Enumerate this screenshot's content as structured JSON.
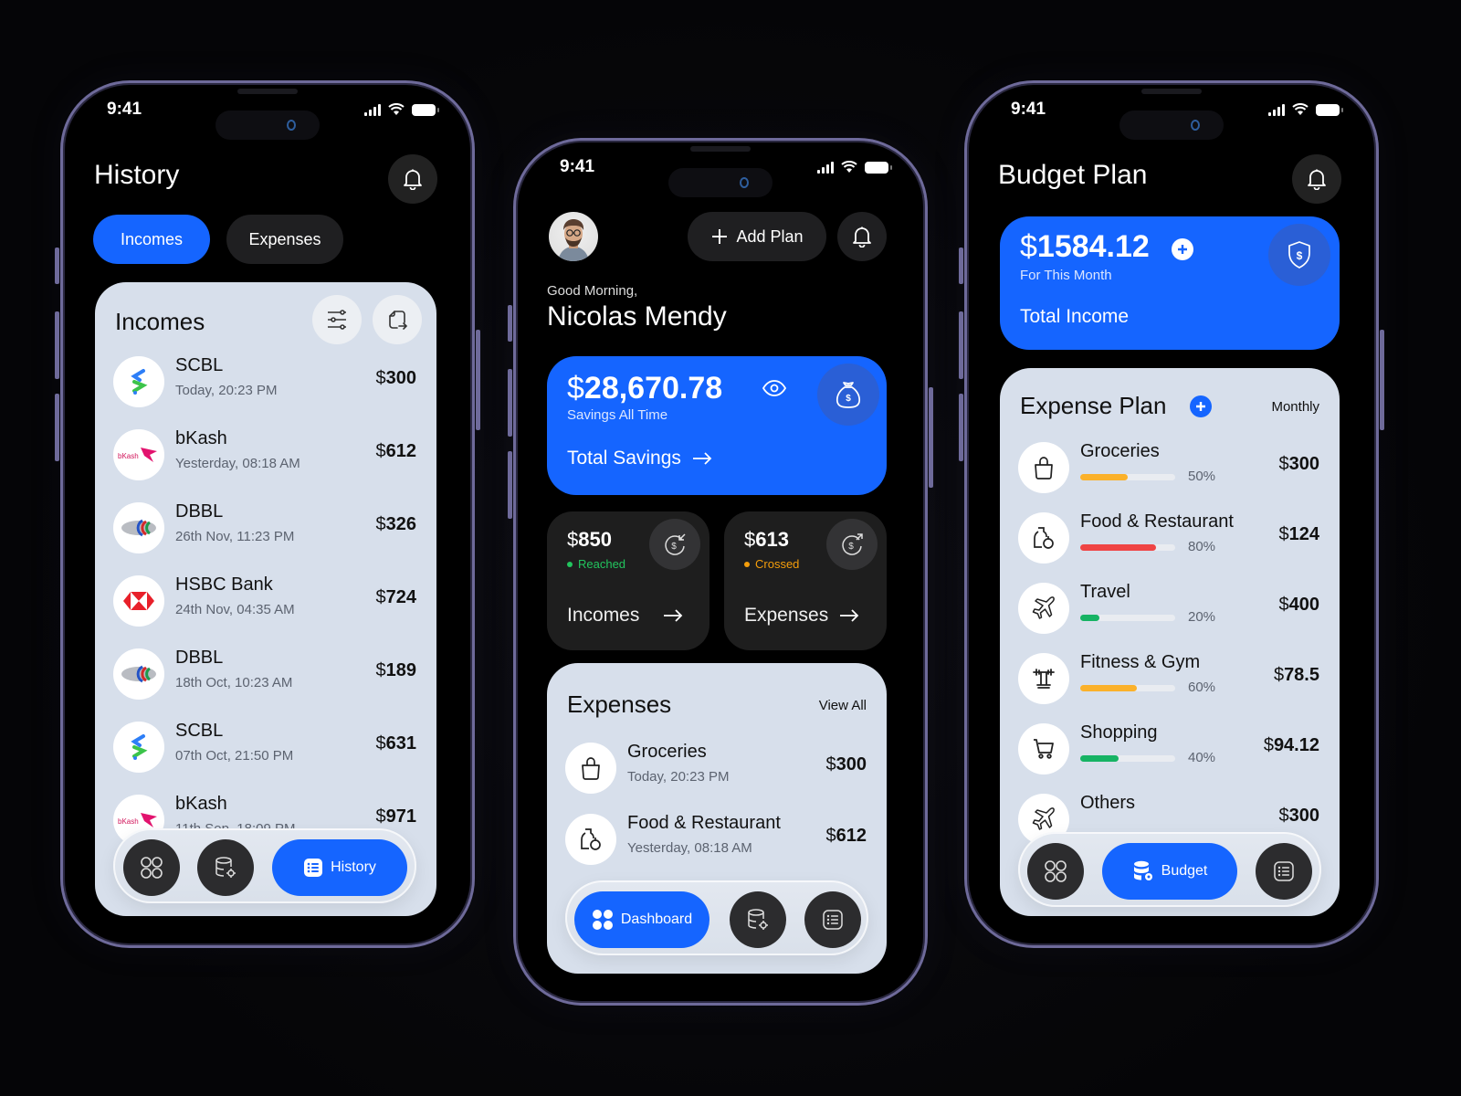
{
  "status_bar": {
    "time": "9:41"
  },
  "colors": {
    "accent": "#1565ff",
    "reached": "#22c55e",
    "crossed": "#f59e0b",
    "bar_yellow": "#fbb12a",
    "bar_red": "#ef4444",
    "bar_green": "#16b364"
  },
  "history_screen": {
    "title": "History",
    "tabs": [
      {
        "label": "Incomes",
        "active": true
      },
      {
        "label": "Expenses",
        "active": false
      }
    ],
    "panel_title": "Incomes",
    "panel_icons": [
      "filter-sliders-icon",
      "export-icon"
    ],
    "transactions": [
      {
        "name": "SCBL",
        "time": "Today, 20:23 PM",
        "currency": "$",
        "amount": "300",
        "logo": "scbl-logo"
      },
      {
        "name": "bKash",
        "time": "Yesterday, 08:18 AM",
        "currency": "$",
        "amount": "612",
        "logo": "bkash-logo"
      },
      {
        "name": "DBBL",
        "time": "26th Nov, 11:23 PM",
        "currency": "$",
        "amount": "326",
        "logo": "dbbl-logo"
      },
      {
        "name": "HSBC Bank",
        "time": "24th Nov, 04:35 AM",
        "currency": "$",
        "amount": "724",
        "logo": "hsbc-logo"
      },
      {
        "name": "DBBL",
        "time": "18th Oct, 10:23 AM",
        "currency": "$",
        "amount": "189",
        "logo": "dbbl-logo"
      },
      {
        "name": "SCBL",
        "time": "07th Oct, 21:50 PM",
        "currency": "$",
        "amount": "631",
        "logo": "scbl-logo"
      },
      {
        "name": "bKash",
        "time": "11th Sep, 18:09 PM",
        "currency": "$",
        "amount": "971",
        "logo": "bkash-logo"
      }
    ],
    "nav": {
      "active_label": "History"
    }
  },
  "dashboard_screen": {
    "add_plan_label": "Add Plan",
    "greeting": "Good Morning,",
    "user_name": "Nicolas Mendy",
    "savings": {
      "currency": "$",
      "amount": "28,670.78",
      "caption": "Savings All Time",
      "link": "Total Savings"
    },
    "incomes_card": {
      "currency": "$",
      "amount": "850",
      "status": "Reached",
      "label": "Incomes"
    },
    "expenses_card": {
      "currency": "$",
      "amount": "613",
      "status": "Crossed",
      "label": "Expenses"
    },
    "expenses_panel": {
      "title": "Expenses",
      "view_all": "View All",
      "items": [
        {
          "name": "Groceries",
          "time": "Today, 20:23 PM",
          "currency": "$",
          "amount": "300",
          "icon": "shopping-bag-icon"
        },
        {
          "name": "Food & Restaurant",
          "time": "Yesterday, 08:18 AM",
          "currency": "$",
          "amount": "612",
          "icon": "food-bottle-apple-icon"
        }
      ]
    },
    "nav": {
      "active_label": "Dashboard"
    }
  },
  "budget_screen": {
    "title": "Budget Plan",
    "income": {
      "currency": "$",
      "amount": "1584.12",
      "caption": "For This Month",
      "label": "Total Income"
    },
    "plan_title": "Expense Plan",
    "period": "Monthly",
    "plans": [
      {
        "name": "Groceries",
        "percent": 50,
        "percent_label": "50%",
        "currency": "$",
        "amount": "300",
        "color": "#fbb12a",
        "icon": "shopping-bag-icon"
      },
      {
        "name": "Food & Restaurant",
        "percent": 80,
        "percent_label": "80%",
        "currency": "$",
        "amount": "124",
        "color": "#ef4444",
        "icon": "food-bottle-apple-icon"
      },
      {
        "name": "Travel",
        "percent": 20,
        "percent_label": "20%",
        "currency": "$",
        "amount": "400",
        "color": "#16b364",
        "icon": "airplane-icon"
      },
      {
        "name": "Fitness & Gym",
        "percent": 60,
        "percent_label": "60%",
        "currency": "$",
        "amount": "78.5",
        "color": "#fbb12a",
        "icon": "dumbbell-icon"
      },
      {
        "name": "Shopping",
        "percent": 40,
        "percent_label": "40%",
        "currency": "$",
        "amount": "94.12",
        "color": "#16b364",
        "icon": "shopping-cart-icon"
      },
      {
        "name": "Others",
        "percent": null,
        "percent_label": "",
        "currency": "$",
        "amount": "300",
        "color": "#16b364",
        "icon": "airplane-icon"
      }
    ],
    "nav": {
      "active_label": "Budget"
    }
  }
}
